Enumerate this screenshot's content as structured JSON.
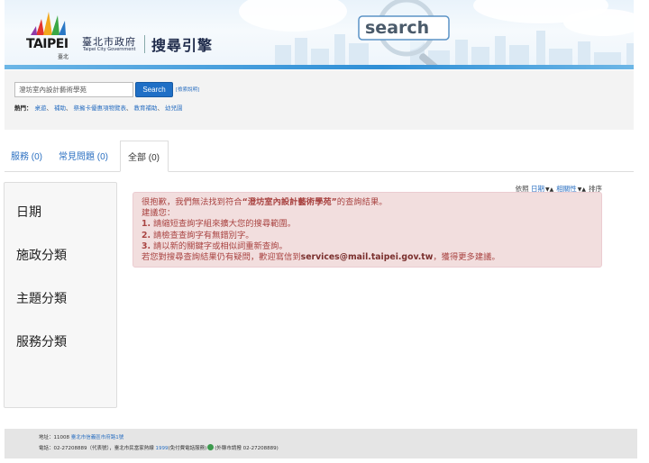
{
  "header": {
    "logo_text": "TAIPEI",
    "logo_sub": "臺北",
    "gov_name": "臺北市政府",
    "gov_name_en": "Taipei City Government",
    "site_title": "搜尋引擎",
    "search_art_text": "search",
    "logo_icon": "taipei-logo-icon"
  },
  "search": {
    "value": "澄坊室內設計藝術學苑",
    "button_label": "Search",
    "help_label": "[檢索說明]",
    "hot_label": "熱門：",
    "hot_items": [
      "桌遊",
      "補助",
      "祭擁卡優惠項物覽表",
      "教育補助",
      "幼兒園"
    ],
    "hot_sep": "、"
  },
  "tabs": [
    {
      "label": "服務 (0)",
      "active": false
    },
    {
      "label": "常見問題 (0)",
      "active": false
    },
    {
      "label": "全部 (0)",
      "active": true
    }
  ],
  "sort": {
    "prefix": "依照",
    "date": "日期",
    "relevance": "相關性",
    "suffix": "排序",
    "arrows": "▼▲"
  },
  "facets": [
    "日期",
    "施政分類",
    "主題分類",
    "服務分類"
  ],
  "alert": {
    "line1_pre": "很抱歉，我們無法找到符合",
    "line1_kw": "“澄坊室內設計藝術學苑”",
    "line1_post": "的查詢結果。",
    "line2": "建議您：",
    "tip1_num": "1.",
    "tip1": "請縮短查詢字組來擴大您的搜尋範圍。",
    "tip2_num": "2.",
    "tip2": "請檢查查詢字有無錯別字。",
    "tip3_num": "3.",
    "tip3": "請以新的關鍵字或相似詞重新查詢。",
    "line6_pre": "若您對搜尋查詢結果仍有疑問，歡迎寫信到",
    "line6_mail": "services@mail.taipei.gov.tw",
    "line6_post": "，獲得更多建議。"
  },
  "footer": {
    "addr_label": "地址：11008",
    "addr_link": "臺北市信義區市府路1號",
    "phone_pre": "電話：02-27208889（代表號），臺北市民當家熱線",
    "phone_link": "1999",
    "phone_mid": "(免付費電話服務)",
    "phone_post": "(外縣市請撥 02-27208889)"
  },
  "colors": {
    "accent": "#1f6fc6",
    "link": "#2a6fc1",
    "alert_bg": "#f2dede",
    "alert_text": "#a94442"
  }
}
